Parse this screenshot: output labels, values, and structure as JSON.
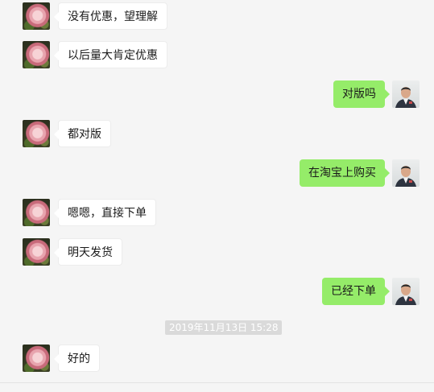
{
  "conversation": {
    "messages": [
      {
        "side": "left",
        "avatar": "rose-avatar",
        "text": "没有优惠，望理解"
      },
      {
        "side": "left",
        "avatar": "rose-avatar",
        "text": "以后量大肯定优惠"
      },
      {
        "side": "right",
        "avatar": "man-avatar",
        "text": "对版吗"
      },
      {
        "side": "left",
        "avatar": "rose-avatar",
        "text": "都对版"
      },
      {
        "side": "right",
        "avatar": "man-avatar",
        "text": "在淘宝上购买"
      },
      {
        "side": "left",
        "avatar": "rose-avatar",
        "text": "嗯嗯，直接下单"
      },
      {
        "side": "left",
        "avatar": "rose-avatar",
        "text": "明天发货"
      },
      {
        "side": "right",
        "avatar": "man-avatar",
        "text": "已经下单"
      },
      {
        "side": "left",
        "avatar": "rose-avatar",
        "text": "好的"
      }
    ],
    "timestamp": "2019年11月13日 15:28"
  },
  "colors": {
    "background": "#f5f5f5",
    "incoming_bubble": "#ffffff",
    "outgoing_bubble": "#95ec69",
    "timestamp_bg": "#dadada"
  }
}
